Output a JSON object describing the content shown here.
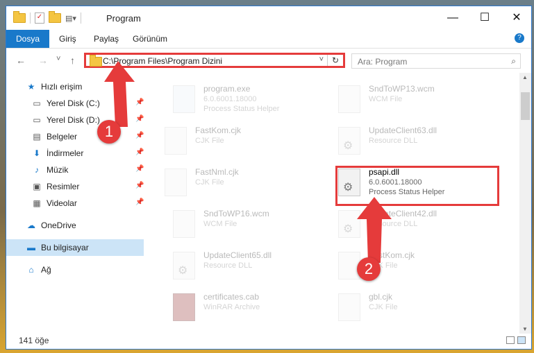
{
  "window": {
    "title": "Program",
    "controls": {
      "minimize": "—",
      "maximize": "☐",
      "close": "✕"
    }
  },
  "ribbon": {
    "tabs": [
      "Dosya",
      "Giriş",
      "Paylaş",
      "Görünüm"
    ],
    "help": "?"
  },
  "nav": {
    "back": "←",
    "forward": "→",
    "recent": "˅",
    "up": "↑"
  },
  "address": {
    "path": "C:\\Program Files\\Program Dizini",
    "dropdown": "˅",
    "refresh": "↻"
  },
  "search": {
    "placeholder": "Ara: Program",
    "icon": "⌕"
  },
  "sidebar": {
    "items": [
      {
        "label": "Hızlı erişim",
        "icon": "★"
      },
      {
        "label": "Yerel Disk (C:)",
        "icon": "▭",
        "pin": "📌"
      },
      {
        "label": "Yerel Disk (D:)",
        "icon": "▭",
        "pin": "📌"
      },
      {
        "label": "Belgeler",
        "icon": "▤",
        "pin": "📌"
      },
      {
        "label": "İndirmeler",
        "icon": "⬇",
        "pin": "📌"
      },
      {
        "label": "Müzik",
        "icon": "♪",
        "pin": "📌"
      },
      {
        "label": "Resimler",
        "icon": "▣",
        "pin": "📌"
      },
      {
        "label": "Videolar",
        "icon": "▦",
        "pin": "📌"
      },
      {
        "label": "OneDrive",
        "icon": "☁"
      },
      {
        "label": "Bu bilgisayar",
        "icon": "▬"
      },
      {
        "label": "Ağ",
        "icon": "⌂"
      }
    ]
  },
  "files": [
    {
      "name": "program.exe",
      "line1": "6.0.6001.18000",
      "line2": "Process Status Helper",
      "icon": "exe"
    },
    {
      "name": "SndToWP13.wcm",
      "line1": "WCM File",
      "line2": "",
      "icon": "doc"
    },
    {
      "name": "FastKom.cjk",
      "line1": "CJK File",
      "line2": "",
      "icon": "doc"
    },
    {
      "name": "UpdateClient63.dll",
      "line1": "Resource DLL",
      "line2": "",
      "icon": "dll"
    },
    {
      "name": "FastNml.cjk",
      "line1": "CJK File",
      "line2": "",
      "icon": "doc"
    },
    {
      "name": "psapi.dll",
      "line1": "6.0.6001.18000",
      "line2": "Process Status Helper",
      "icon": "dll"
    },
    {
      "name": "SndToWP16.wcm",
      "line1": "WCM File",
      "line2": "",
      "icon": "doc"
    },
    {
      "name": "UpdateClient42.dll",
      "line1": "Resource DLL",
      "line2": "",
      "icon": "dll"
    },
    {
      "name": "UpdateClient65.dll",
      "line1": "Resource DLL",
      "line2": "",
      "icon": "dll"
    },
    {
      "name": "FastKom.cjk",
      "line1": "CJK File",
      "line2": "",
      "icon": "doc"
    },
    {
      "name": "certificates.cab",
      "line1": "WinRAR Archive",
      "line2": "",
      "icon": "cab"
    },
    {
      "name": "gbl.cjk",
      "line1": "CJK File",
      "line2": "",
      "icon": "doc"
    }
  ],
  "status": {
    "count": "141 öğe"
  },
  "annotations": {
    "step1": "1",
    "step2": "2",
    "color": "#e53b3b"
  }
}
